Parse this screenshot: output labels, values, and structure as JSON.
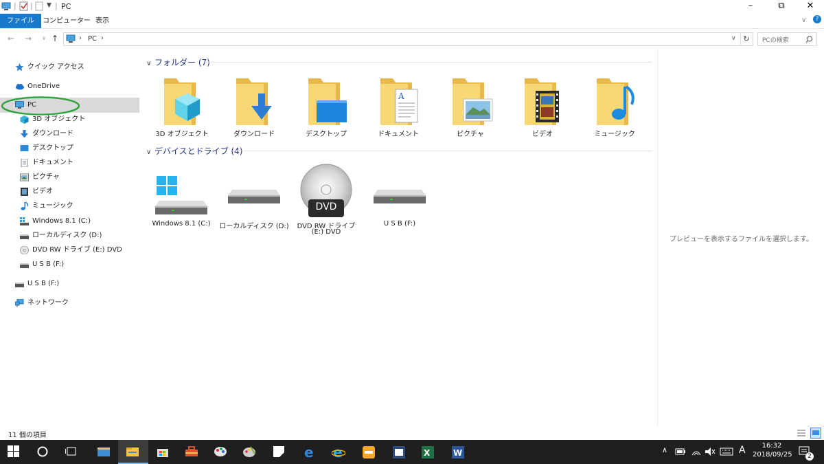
{
  "window": {
    "title": "PC"
  },
  "ribbon": {
    "tabs": [
      {
        "label": "ファイル",
        "active": true
      },
      {
        "label": "コンピューター"
      },
      {
        "label": "表示"
      }
    ]
  },
  "address": {
    "path": "PC",
    "search_placeholder": "PCの検索"
  },
  "nav": {
    "items": [
      {
        "label": "クイック アクセス",
        "icon": "star-icon"
      },
      {
        "label": "OneDrive",
        "icon": "cloud-icon"
      },
      {
        "label": "PC",
        "icon": "computer-icon",
        "selected": true
      },
      {
        "label": "3D オブジェクト",
        "icon": "cube-icon"
      },
      {
        "label": "ダウンロード",
        "icon": "download-arrow-icon"
      },
      {
        "label": "デスクトップ",
        "icon": "desktop-icon"
      },
      {
        "label": "ドキュメント",
        "icon": "document-icon"
      },
      {
        "label": "ピクチャ",
        "icon": "picture-icon"
      },
      {
        "label": "ビデオ",
        "icon": "film-icon"
      },
      {
        "label": "ミュージック",
        "icon": "music-note-icon"
      },
      {
        "label": "Windows 8.1 (C:)",
        "icon": "drive-icon"
      },
      {
        "label": "ローカルディスク (D:)",
        "icon": "drive-icon"
      },
      {
        "label": "DVD RW ドライブ (E:) DVD",
        "icon": "disc-icon"
      },
      {
        "label": "U S B (F:)",
        "icon": "drive-icon"
      },
      {
        "label": "U S B (F:)",
        "icon": "drive-icon"
      },
      {
        "label": "ネットワーク",
        "icon": "network-icon"
      }
    ]
  },
  "folders": {
    "header": "フォルダー (7)",
    "items": [
      {
        "label": "3D オブジェクト",
        "icon": "cube-icon"
      },
      {
        "label": "ダウンロード",
        "icon": "download-arrow-icon"
      },
      {
        "label": "デスクトップ",
        "icon": "desktop-icon"
      },
      {
        "label": "ドキュメント",
        "icon": "document-icon"
      },
      {
        "label": "ピクチャ",
        "icon": "picture-icon"
      },
      {
        "label": "ビデオ",
        "icon": "film-icon"
      },
      {
        "label": "ミュージック",
        "icon": "music-note-icon"
      }
    ]
  },
  "devices": {
    "header": "デバイスとドライブ (4)",
    "items": [
      {
        "label": "Windows 8.1 (C:)",
        "icon": "windows-drive-icon"
      },
      {
        "label": "ローカルディスク (D:)",
        "icon": "drive-icon"
      },
      {
        "label": "DVD RW ドライブ",
        "label2": "(E:) DVD",
        "icon": "dvd-disc-icon",
        "badge": "DVD"
      },
      {
        "label": "U S B (F:)",
        "icon": "drive-icon"
      }
    ]
  },
  "preview": {
    "message": "プレビューを表示するファイルを選択します。"
  },
  "status": {
    "count": "11 個の項目"
  },
  "taskbar": {
    "time": "16:32",
    "date": "2018/09/25",
    "ime": "A",
    "notifications": "2"
  },
  "colors": {
    "accent": "#1979ca",
    "folder": "#f8d775",
    "taskbar": "#1f1f1f",
    "highlight_oval": "#2ea43a"
  }
}
